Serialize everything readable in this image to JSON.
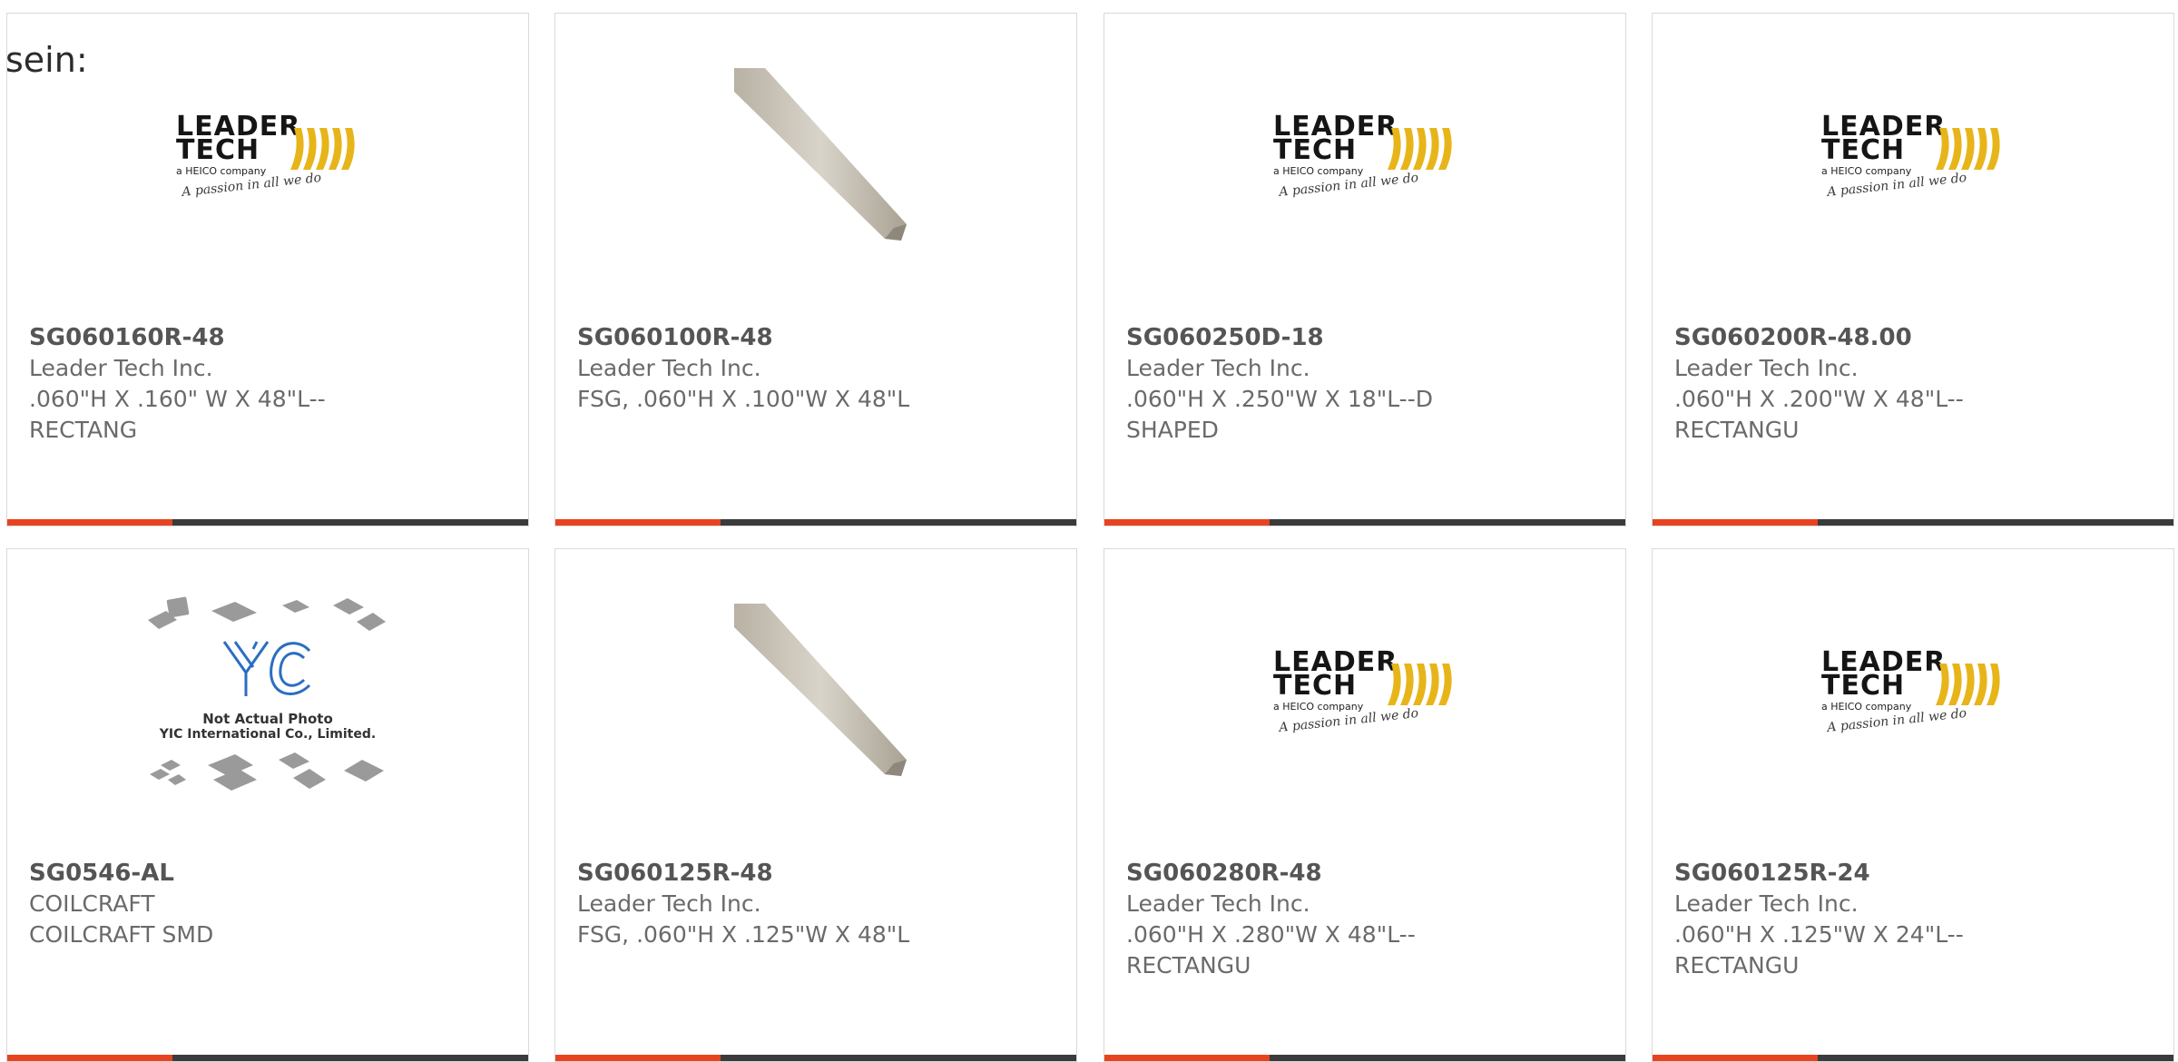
{
  "lead_text": "sein:",
  "colors": {
    "accent": "#e8431f",
    "bar": "#3b3b3b",
    "title": "#555555",
    "text": "#6a6a6a"
  },
  "logos": {
    "leader_tech": {
      "line1": "LEADER",
      "line2": "TECH",
      "sub": "a HEICO company",
      "tag": "A passion in all we do"
    },
    "yic": {
      "line1": "Not Actual Photo",
      "line2": "YIC International Co., Limited."
    }
  },
  "products": [
    {
      "pn": "SG060160R-48",
      "mfr": "Leader Tech Inc.",
      "desc": ".060\"H X .160\" W X 48\"L--\nRECTANG",
      "image": "leader-tech-logo"
    },
    {
      "pn": "SG060100R-48",
      "mfr": "Leader Tech Inc.",
      "desc": "FSG, .060\"H X .100\"W X 48\"L",
      "image": "gasket-strip"
    },
    {
      "pn": "SG060250D-18",
      "mfr": "Leader Tech Inc.",
      "desc": ".060\"H X .250\"W X 18\"L--D\nSHAPED",
      "image": "leader-tech-logo"
    },
    {
      "pn": "SG060200R-48.00",
      "mfr": "Leader Tech Inc.",
      "desc": ".060\"H X .200\"W X 48\"L--\nRECTANGU",
      "image": "leader-tech-logo"
    },
    {
      "pn": "SG0546-AL",
      "mfr": "COILCRAFT",
      "desc": "COILCRAFT SMD",
      "image": "yic-placeholder"
    },
    {
      "pn": "SG060125R-48",
      "mfr": "Leader Tech Inc.",
      "desc": "FSG, .060\"H X .125\"W X 48\"L",
      "image": "gasket-strip"
    },
    {
      "pn": "SG060280R-48",
      "mfr": "Leader Tech Inc.",
      "desc": ".060\"H X .280\"W X 48\"L--\nRECTANGU",
      "image": "leader-tech-logo"
    },
    {
      "pn": "SG060125R-24",
      "mfr": "Leader Tech Inc.",
      "desc": ".060\"H X .125\"W X 24\"L--\nRECTANGU",
      "image": "leader-tech-logo"
    }
  ]
}
